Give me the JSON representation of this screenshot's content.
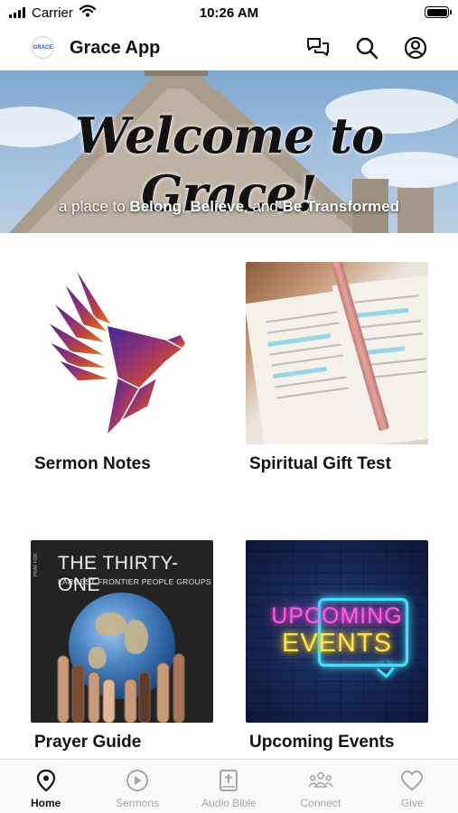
{
  "status_bar": {
    "carrier": "Carrier",
    "time": "10:26 AM",
    "battery_percent": 100
  },
  "header": {
    "title": "Grace App",
    "logo_text": "GRACE",
    "icons": [
      "chat-icon",
      "search-icon",
      "profile-icon"
    ]
  },
  "banner": {
    "title": "Welcome to Grace!",
    "tagline_lead": "a place to ",
    "tagline_w1": "Belong",
    "tagline_sep1": ", ",
    "tagline_w2": "Believe",
    "tagline_sep2": ", and ",
    "tagline_w3": "Be Transformed"
  },
  "tiles": [
    {
      "label": "Sermon Notes",
      "image": "dove-image"
    },
    {
      "label": "Spiritual Gift Test",
      "image": "open-bible-image"
    },
    {
      "label": "Prayer Guide",
      "image": "globe-hands-image",
      "image_text_1": "THE THIRTY-ONE",
      "image_text_2": "LARGEST FRONTIER PEOPLE GROUPS",
      "image_side_text": "PRAY FOR"
    },
    {
      "label": "Upcoming Events",
      "image": "neon-sign-image",
      "image_text_1": "UPCOMING",
      "image_text_2": "EVENTS"
    }
  ],
  "tab_bar": {
    "active": "Home",
    "tabs": [
      {
        "label": "Home",
        "icon": "map-pin-icon"
      },
      {
        "label": "Sermons",
        "icon": "play-circle-icon"
      },
      {
        "label": "Audio Bible",
        "icon": "bible-icon"
      },
      {
        "label": "Connect",
        "icon": "group-icon"
      },
      {
        "label": "Give",
        "icon": "heart-icon"
      }
    ]
  },
  "colors": {
    "active_tab": "#111111",
    "inactive_tab": "#a6a6a6",
    "neon_pink": "#ff5fd9",
    "neon_yellow": "#ffe34a",
    "neon_cyan": "#3fe4ff"
  }
}
